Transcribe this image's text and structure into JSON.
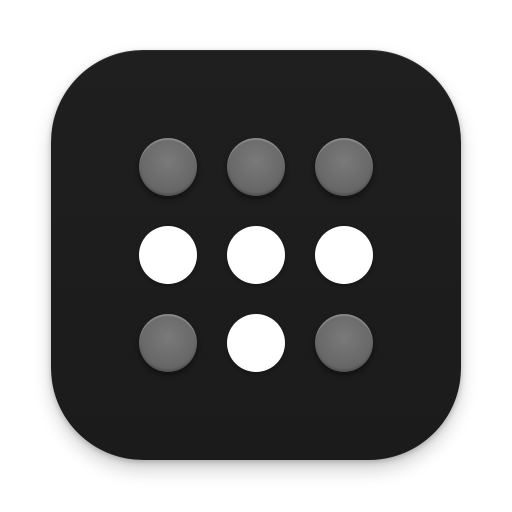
{
  "app_icon": {
    "name": "dot-grid-app-icon",
    "colors": {
      "tile_background": "#1c1c1c",
      "dot_on": "#ffffff",
      "dot_off": "#6b6b6b",
      "page_background": "#ffffff"
    },
    "grid": {
      "rows": 3,
      "columns": 3,
      "states": [
        [
          "off",
          "off",
          "off"
        ],
        [
          "on",
          "on",
          "on"
        ],
        [
          "off",
          "on",
          "off"
        ]
      ]
    }
  }
}
